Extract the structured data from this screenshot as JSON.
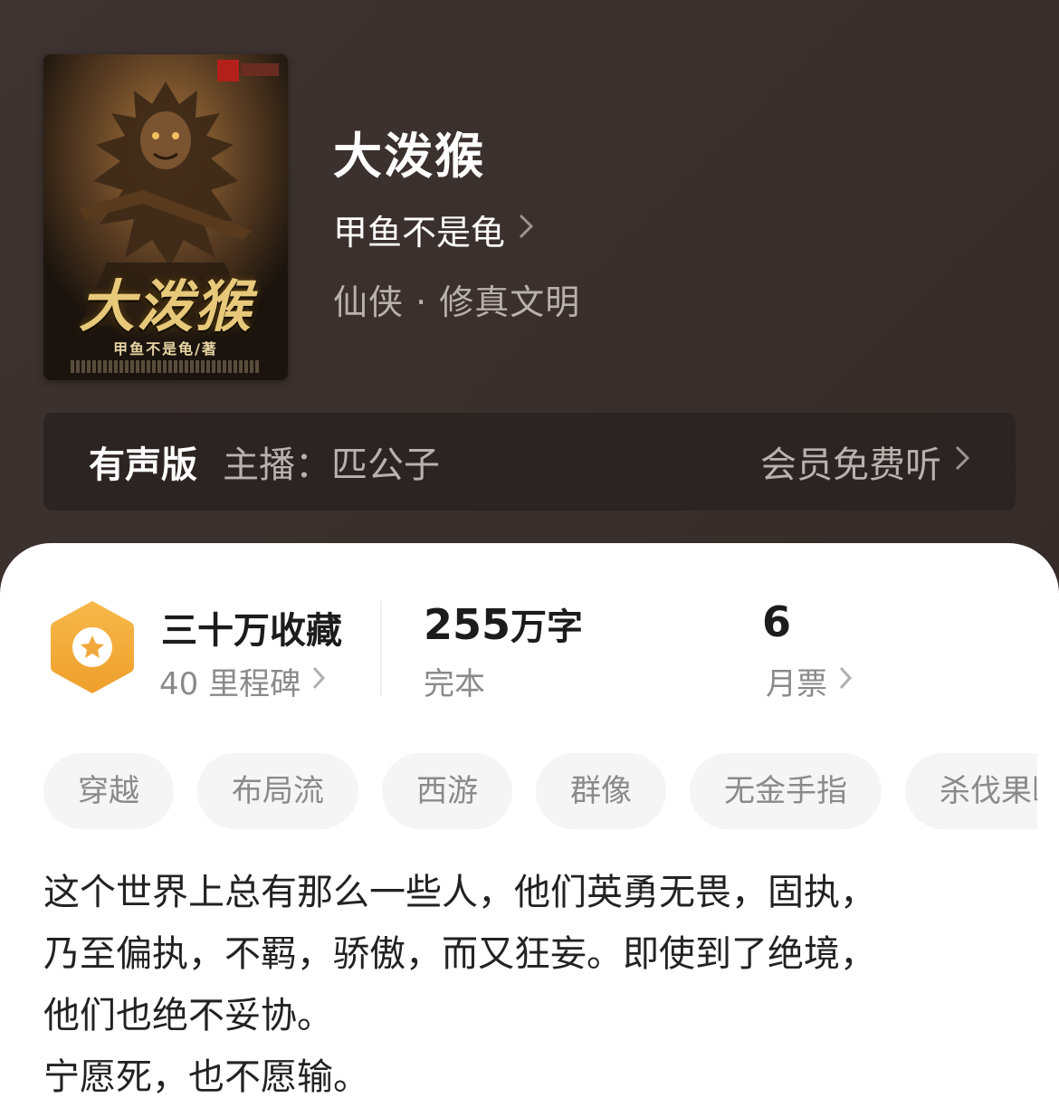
{
  "book": {
    "title": "大泼猴",
    "author": "甲鱼不是龟",
    "genre": "仙侠 · 修真文明",
    "cover": {
      "title_art": "大泼猴",
      "author_art": "甲鱼不是龟/著"
    }
  },
  "audio": {
    "label": "有声版",
    "narrator": "主播：匹公子",
    "listen_label": "会员免费听"
  },
  "stats": {
    "collections": "三十万收藏",
    "milestones": "40 里程碑",
    "word_count_num": "255",
    "word_count_unit": "万字",
    "status": "完本",
    "monthly_votes_num": "6",
    "monthly_votes_label": "月票"
  },
  "tags": [
    "穿越",
    "布局流",
    "西游",
    "群像",
    "无金手指",
    "杀伐果断"
  ],
  "description": [
    "这个世界上总有那么一些人，他们英勇无畏，固执，",
    "乃至偏执，不羁，骄傲，而又狂妄。即使到了绝境，",
    "他们也绝不妥协。",
    "宁愿死，也不愿输。"
  ],
  "colors": {
    "hero_bg": "#3a302d",
    "badge_orange": "#f2a93b",
    "cover_gold": "#e8c97a"
  },
  "icons": {
    "chevron": "chevron-right-icon",
    "badge": "star-hexagon-icon"
  }
}
